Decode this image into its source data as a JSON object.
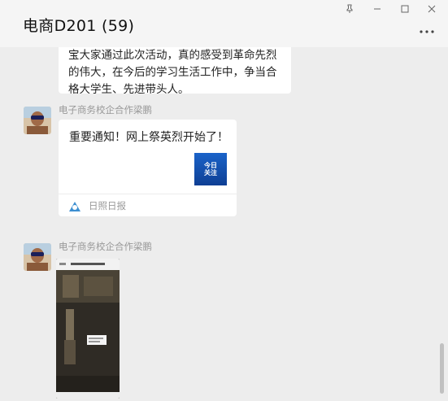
{
  "window": {
    "title": "电商D201 (59)",
    "buttons": {
      "pin_icon": "pin-icon",
      "minimize_icon": "minimize-icon",
      "maximize_icon": "maximize-icon",
      "close_icon": "close-icon",
      "more_icon": "more-icon"
    }
  },
  "messages": [
    {
      "type": "text",
      "lines": [
        "宝大家通过此次活动，真的感受到革命先烈",
        "的伟大，在今后的学习生活工作中，争当合",
        "格大学生、先进带头人。"
      ]
    },
    {
      "type": "link_card",
      "sender": "电子商务校企合作梁鹏",
      "card_title": "重要通知！网上祭英烈开始了！",
      "thumb_text": [
        "今日",
        "关注"
      ],
      "source": "日照日报"
    },
    {
      "type": "image",
      "sender": "电子商务校企合作梁鹏"
    }
  ],
  "colors": {
    "background": "#ededed",
    "bubble": "#ffffff",
    "sender_text": "#999999",
    "card_thumb": "#1a63c9"
  }
}
